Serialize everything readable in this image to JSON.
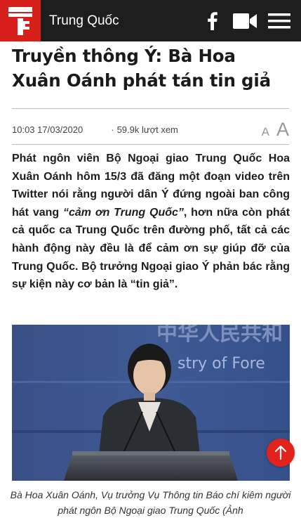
{
  "header": {
    "section": "Trung Quốc",
    "icons": [
      "logo-icon",
      "facebook-icon",
      "video-camera-icon",
      "hamburger-menu-icon"
    ]
  },
  "article": {
    "title": "Truyền thông Ý: Bà Hoa Xuân Oánh phát tán tin giả",
    "datetime": "10:03 17/03/2020",
    "views": "59.9k lượt xem",
    "font_small": "A",
    "font_large": "A",
    "lead_part1": "Phát ngôn viên Bộ Ngoại giao Trung Quốc Hoa Xuân Oánh hôm 15/3 đã đăng một đoạn video trên Twitter nói rằng người dân Ý đứng ngoài ban công hát vang ",
    "lead_quote": "“cảm ơn Trung Quốc”",
    "lead_part2": ", hơn nữa còn phát cả quốc ca Trung Quốc trên đường phố, tất cả các hành động này đều là để cảm ơn sự giúp đỡ của Trung Quốc. Bộ trưởng Ngoại giao Ý phản bác rằng sự kiện này cơ bản là “tin giả”.",
    "photo": {
      "backdrop_text_cn": "中华人民共和",
      "backdrop_text_en": "stry of Fore"
    },
    "caption": "Bà Hoa Xuân Oánh, Vụ trưởng Vụ Thông tin Báo chí kiêm người phát ngôn Bộ Ngoại giao Trung Quốc (Ảnh"
  },
  "colors": {
    "brand_red": "#d7201c",
    "header_bg": "#1e1e1e",
    "scroll_button": "#e3221b"
  }
}
